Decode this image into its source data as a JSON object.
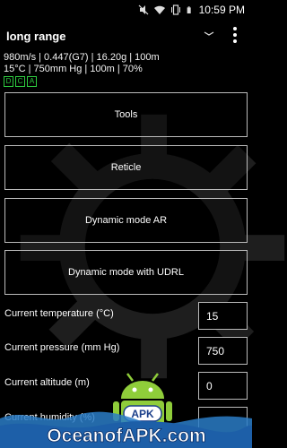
{
  "status_bar": {
    "time": "10:59 PM",
    "icons": [
      "mute-icon",
      "wifi-icon",
      "vibrate-icon",
      "battery-icon"
    ]
  },
  "app_bar": {
    "title": "long range",
    "icons": [
      "chevron-down-icon",
      "more-vert-icon"
    ]
  },
  "info": {
    "line1": "980m/s |  0.447(G7)  |  16.20g | 100m",
    "line2": "15°C |  750mm Hg  |  100m  |  70%",
    "tags": [
      "D",
      "C",
      "A"
    ]
  },
  "buttons": {
    "tools": "Tools",
    "reticle": "Reticle",
    "dynamic_ar": "Dynamic mode AR",
    "dynamic_udrl": "Dynamic mode with UDRL"
  },
  "fields": {
    "temperature": {
      "label": "Current temperature (°C)",
      "value": "15"
    },
    "pressure": {
      "label": "Current pressure (mm Hg)",
      "value": "750"
    },
    "altitude": {
      "label": "Current altitude (m)",
      "value": "0"
    },
    "humidity": {
      "label": "Current humidity (%)",
      "value": ""
    }
  },
  "watermark": {
    "text": "OceanofAPK.com",
    "badge": "APK"
  },
  "colors": {
    "background": "#000000",
    "accent": "#2ecc40"
  }
}
